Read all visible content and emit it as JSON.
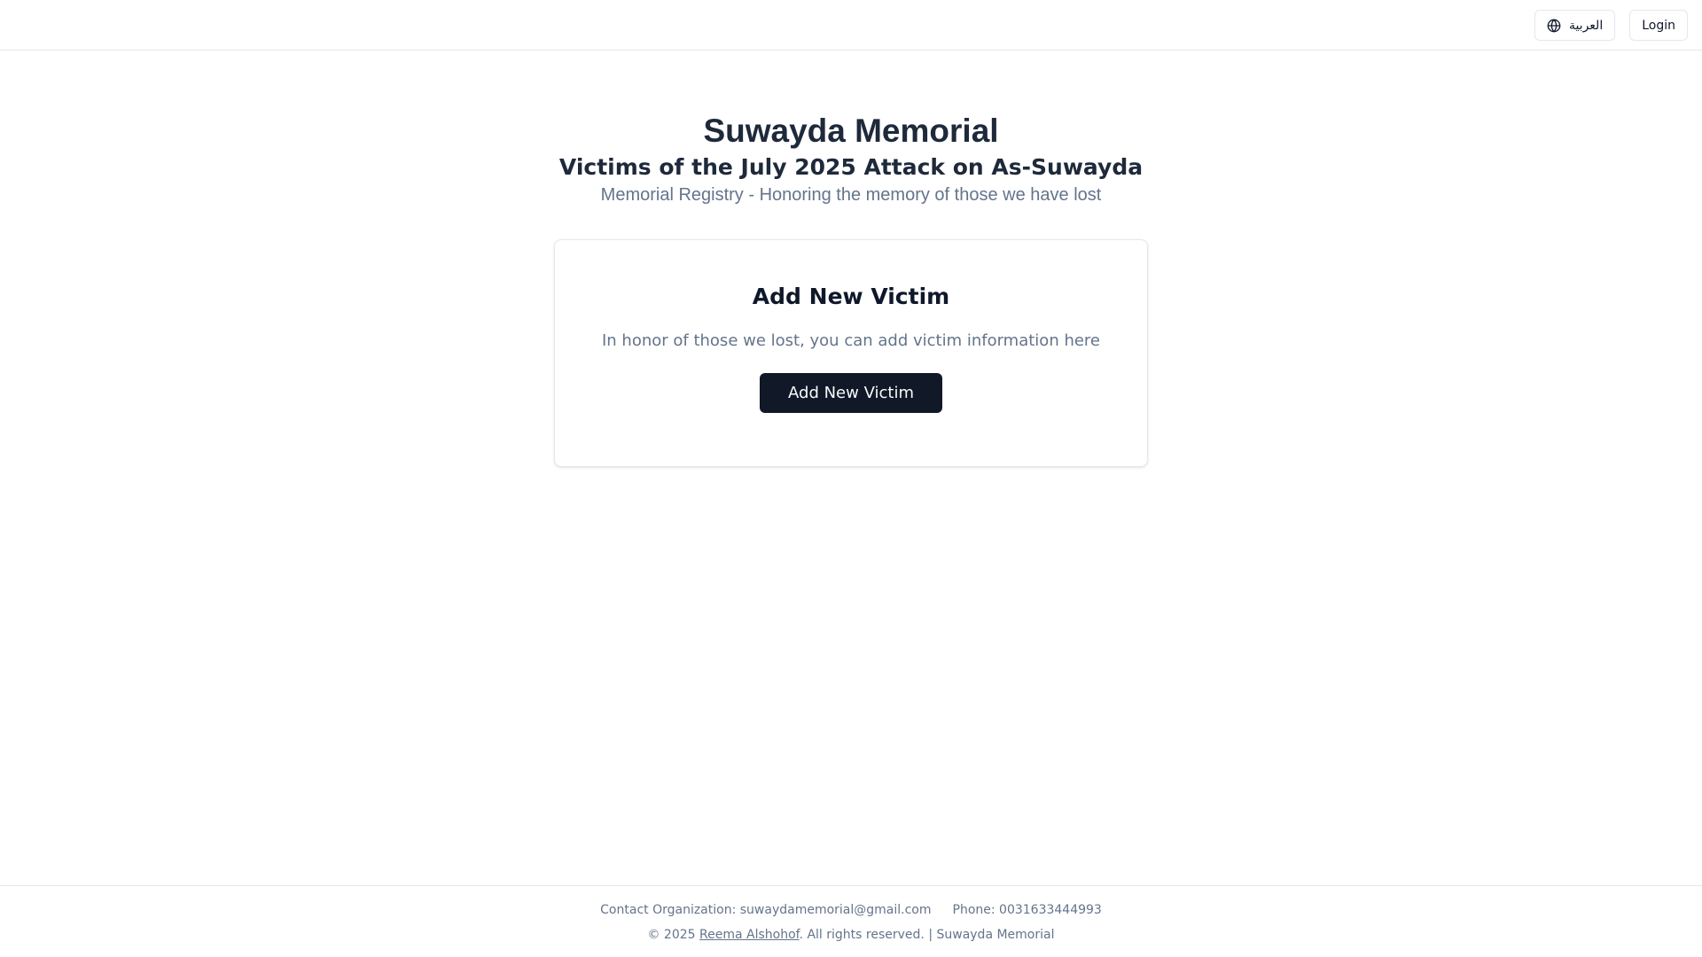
{
  "header": {
    "language_button": {
      "label": "العربية",
      "icon": "globe-icon"
    },
    "login_button": {
      "label": "Login"
    }
  },
  "hero": {
    "title": "Suwayda Memorial",
    "subtitle": "Victims of the July 2025 Attack on As-Suwayda",
    "tagline": "Memorial Registry - Honoring the memory of those we have lost"
  },
  "card": {
    "title": "Add New Victim",
    "description": "In honor of those we lost, you can add victim information here",
    "button_label": "Add New Victim"
  },
  "footer": {
    "contact": "Contact Organization: suwaydamemorial@gmail.com",
    "phone": "Phone: 0031633444993",
    "copyright_prefix": "© 2025 ",
    "author": "Reema Alshohof",
    "copyright_suffix": ". All rights reserved. | Suwayda Memorial"
  },
  "colors": {
    "primary_button": "#111827",
    "heading": "#1e293b",
    "muted_text": "#64748b",
    "border": "#e5e7eb"
  }
}
